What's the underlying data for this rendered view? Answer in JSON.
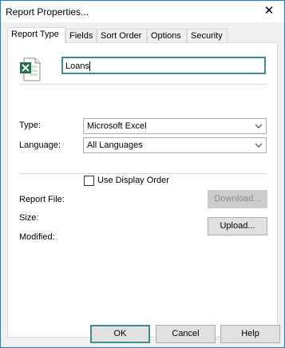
{
  "window": {
    "title": "Report Properties..."
  },
  "tabs": [
    {
      "label": "Report Type"
    },
    {
      "label": "Fields"
    },
    {
      "label": "Sort Order"
    },
    {
      "label": "Options"
    },
    {
      "label": "Security"
    }
  ],
  "report": {
    "name": "Loans"
  },
  "type": {
    "label": "Type:",
    "value": "Microsoft Excel"
  },
  "language": {
    "label": "Language:",
    "value": "All Languages"
  },
  "use_display_order": {
    "label": "Use Display Order",
    "checked": false
  },
  "file_info": {
    "report_file_label": "Report File:",
    "size_label": "Size:",
    "modified_label": "Modified:"
  },
  "buttons": {
    "download": "Download...",
    "upload": "Upload...",
    "ok": "OK",
    "cancel": "Cancel",
    "help": "Help"
  },
  "colors": {
    "window_border": "#1883d7",
    "focus_border": "#3f8f8f",
    "excel_green": "#217346"
  },
  "icons": [
    "close-icon",
    "excel-icon",
    "chevron-down-icon"
  ]
}
